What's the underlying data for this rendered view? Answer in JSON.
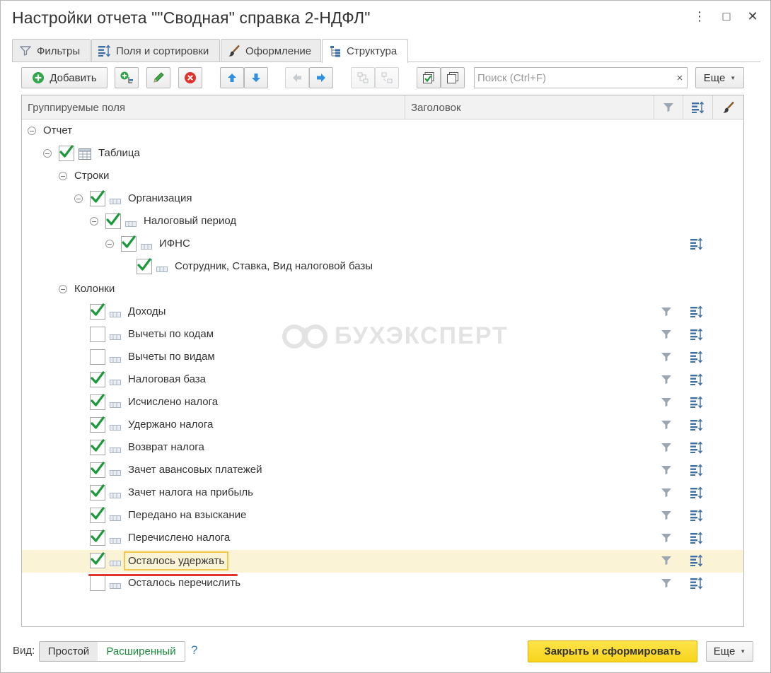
{
  "window": {
    "title": "Настройки отчета \"\"Сводная\" справка 2-НДФЛ\"",
    "menu_glyph": "⋮",
    "maximize_glyph": "□",
    "close_glyph": "✕"
  },
  "tabs": [
    {
      "label": "Фильтры",
      "icon": "filter-icon",
      "active": false
    },
    {
      "label": "Поля и сортировки",
      "icon": "fields-sort-icon",
      "active": false
    },
    {
      "label": "Оформление",
      "icon": "brush-icon",
      "active": false
    },
    {
      "label": "Структура",
      "icon": "structure-icon",
      "active": true
    }
  ],
  "toolbar": {
    "add_label": "Добавить",
    "search_placeholder": "Поиск (Ctrl+F)",
    "search_clear": "×",
    "more_label": "Еще"
  },
  "grid": {
    "columns": {
      "fields": "Группируемые поля",
      "title": "Заголовок"
    },
    "rows": [
      {
        "label": "Отчет",
        "level": 0,
        "toggle": true,
        "checkbox": null,
        "icon": null,
        "filter": false,
        "sort": false
      },
      {
        "label": "Таблица",
        "level": 1,
        "toggle": true,
        "checkbox": true,
        "icon": "table-icon",
        "filter": false,
        "sort": false
      },
      {
        "label": "Строки",
        "level": 2,
        "toggle": true,
        "checkbox": null,
        "icon": null,
        "filter": false,
        "sort": false
      },
      {
        "label": "Организация",
        "level": 3,
        "toggle": true,
        "checkbox": true,
        "icon": "field-icon",
        "filter": false,
        "sort": false
      },
      {
        "label": "Налоговый период",
        "level": 4,
        "toggle": true,
        "checkbox": true,
        "icon": "field-icon",
        "filter": false,
        "sort": false
      },
      {
        "label": "ИФНС",
        "level": 5,
        "toggle": true,
        "checkbox": true,
        "icon": "field-icon",
        "filter": false,
        "sort": true
      },
      {
        "label": "Сотрудник, Ставка, Вид налоговой базы",
        "level": 6,
        "toggle": false,
        "checkbox": true,
        "icon": "field-icon",
        "filter": false,
        "sort": false
      },
      {
        "label": "Колонки",
        "level": 2,
        "toggle": true,
        "checkbox": null,
        "icon": null,
        "filter": false,
        "sort": false
      },
      {
        "label": "Доходы",
        "level": 3,
        "toggle": false,
        "checkbox": true,
        "icon": "field-icon",
        "filter": true,
        "sort": true
      },
      {
        "label": "Вычеты по кодам",
        "level": 3,
        "toggle": false,
        "checkbox": false,
        "icon": "field-icon",
        "filter": true,
        "sort": true
      },
      {
        "label": "Вычеты по видам",
        "level": 3,
        "toggle": false,
        "checkbox": false,
        "icon": "field-icon",
        "filter": true,
        "sort": true
      },
      {
        "label": "Налоговая база",
        "level": 3,
        "toggle": false,
        "checkbox": true,
        "icon": "field-icon",
        "filter": true,
        "sort": true
      },
      {
        "label": "Исчислено налога",
        "level": 3,
        "toggle": false,
        "checkbox": true,
        "icon": "field-icon",
        "filter": true,
        "sort": true
      },
      {
        "label": "Удержано налога",
        "level": 3,
        "toggle": false,
        "checkbox": true,
        "icon": "field-icon",
        "filter": true,
        "sort": true
      },
      {
        "label": "Возврат налога",
        "level": 3,
        "toggle": false,
        "checkbox": true,
        "icon": "field-icon",
        "filter": true,
        "sort": true
      },
      {
        "label": "Зачет авансовых платежей",
        "level": 3,
        "toggle": false,
        "checkbox": true,
        "icon": "field-icon",
        "filter": true,
        "sort": true
      },
      {
        "label": "Зачет налога на прибыль",
        "level": 3,
        "toggle": false,
        "checkbox": true,
        "icon": "field-icon",
        "filter": true,
        "sort": true
      },
      {
        "label": "Передано на взыскание",
        "level": 3,
        "toggle": false,
        "checkbox": true,
        "icon": "field-icon",
        "filter": true,
        "sort": true
      },
      {
        "label": "Перечислено налога",
        "level": 3,
        "toggle": false,
        "checkbox": true,
        "icon": "field-icon",
        "filter": true,
        "sort": true
      },
      {
        "label": "Осталось удержать",
        "level": 3,
        "toggle": false,
        "checkbox": true,
        "icon": "field-icon",
        "filter": true,
        "sort": true,
        "selected": true
      },
      {
        "label": "Осталось перечислить",
        "level": 3,
        "toggle": false,
        "checkbox": false,
        "icon": "field-icon",
        "filter": true,
        "sort": true
      }
    ]
  },
  "watermark": "БУХЭКСПЕРТ",
  "footer": {
    "view_label": "Вид:",
    "simple_label": "Простой",
    "extended_label": "Расширенный",
    "help_label": "?",
    "close_generate_label": "Закрыть и сформировать",
    "more_label": "Еще"
  },
  "colors": {
    "accent_yellow": "#f8d41d",
    "check_green": "#1a9a3a",
    "selected_row": "#fbf3d5",
    "highlight_border": "#f2c94c",
    "underline_red": "#e0332b",
    "link_green": "#1a8a3a",
    "icon_blue": "#3d6fa8"
  }
}
